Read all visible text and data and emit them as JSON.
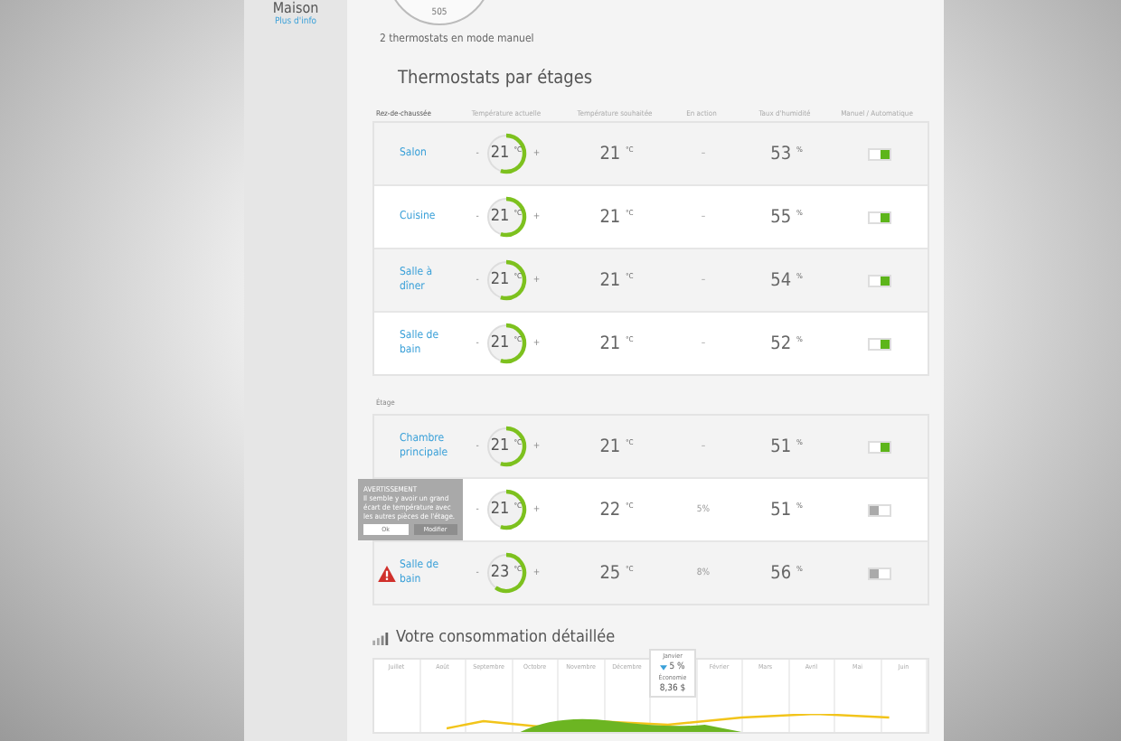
{
  "sidebar": {
    "title": "Maison",
    "link": "Plus d'info"
  },
  "summary": {
    "gauge_value": "505",
    "note": "2 thermostats en mode manuel"
  },
  "section_title": "Thermostats par étages",
  "columns": [
    "Rez-de-chaussée",
    "Température actuelle",
    "Température souhaitée",
    "En action",
    "Taux d'humidité",
    "Manuel / Automatique"
  ],
  "floors": [
    {
      "rooms": [
        {
          "name": "Salon",
          "dec": "-",
          "current": "21",
          "current_unit": "°C",
          "inc": "+",
          "level": 0.55,
          "target": "21",
          "target_unit": "°C",
          "action": "–",
          "humidity": "53",
          "humidity_unit": "%",
          "automatic": true,
          "warning": false
        },
        {
          "name": "Cuisine",
          "dec": "-",
          "current": "21",
          "current_unit": "°C",
          "inc": "+",
          "level": 0.55,
          "target": "21",
          "target_unit": "°C",
          "action": "–",
          "humidity": "55",
          "humidity_unit": "%",
          "automatic": true,
          "warning": false
        },
        {
          "name": "Salle à dîner",
          "dec": "-",
          "current": "21",
          "current_unit": "°C",
          "inc": "+",
          "level": 0.55,
          "target": "21",
          "target_unit": "°C",
          "action": "–",
          "humidity": "54",
          "humidity_unit": "%",
          "automatic": true,
          "warning": false
        },
        {
          "name": "Salle de bain",
          "dec": "-",
          "current": "21",
          "current_unit": "°C",
          "inc": "+",
          "level": 0.55,
          "target": "21",
          "target_unit": "°C",
          "action": "–",
          "humidity": "52",
          "humidity_unit": "%",
          "automatic": true,
          "warning": false
        }
      ]
    },
    {
      "label": "Étage",
      "rooms": [
        {
          "name": "Chambre principale",
          "dec": "-",
          "current": "21",
          "current_unit": "°C",
          "inc": "+",
          "level": 0.55,
          "target": "21",
          "target_unit": "°C",
          "action": "–",
          "humidity": "51",
          "humidity_unit": "%",
          "automatic": true,
          "warning": false
        },
        {
          "dec": "-",
          "current": "21",
          "current_unit": "°C",
          "inc": "+",
          "level": 0.55,
          "target": "22",
          "target_unit": "°C",
          "action": "5%",
          "humidity": "51",
          "humidity_unit": "%",
          "automatic": false
        },
        {
          "name": "Salle de bain",
          "dec": "-",
          "current": "23",
          "current_unit": "°C",
          "inc": "+",
          "level": 0.6,
          "target": "25",
          "target_unit": "°C",
          "action": "8%",
          "humidity": "56",
          "humidity_unit": "%",
          "automatic": false,
          "warning": true
        }
      ]
    }
  ],
  "tooltip": {
    "title": "AVERTISSEMENT",
    "text": "Il semble y avoir un grand écart de température avec les autres pièces de l'étage.",
    "buttons": [
      "Ok",
      "Modifier"
    ]
  },
  "consumption": {
    "title": "Votre consommation détaillée",
    "months_before": [
      "Juillet",
      "Août",
      "Septembre",
      "Octobre",
      "Novembre",
      "Décembre"
    ],
    "popup": {
      "month": "Janvier",
      "change": "5 %",
      "label": "Économie",
      "amount": "8,36 $"
    },
    "months_after": [
      "Février",
      "Mars",
      "Avril",
      "Mai",
      "Juin"
    ]
  }
}
